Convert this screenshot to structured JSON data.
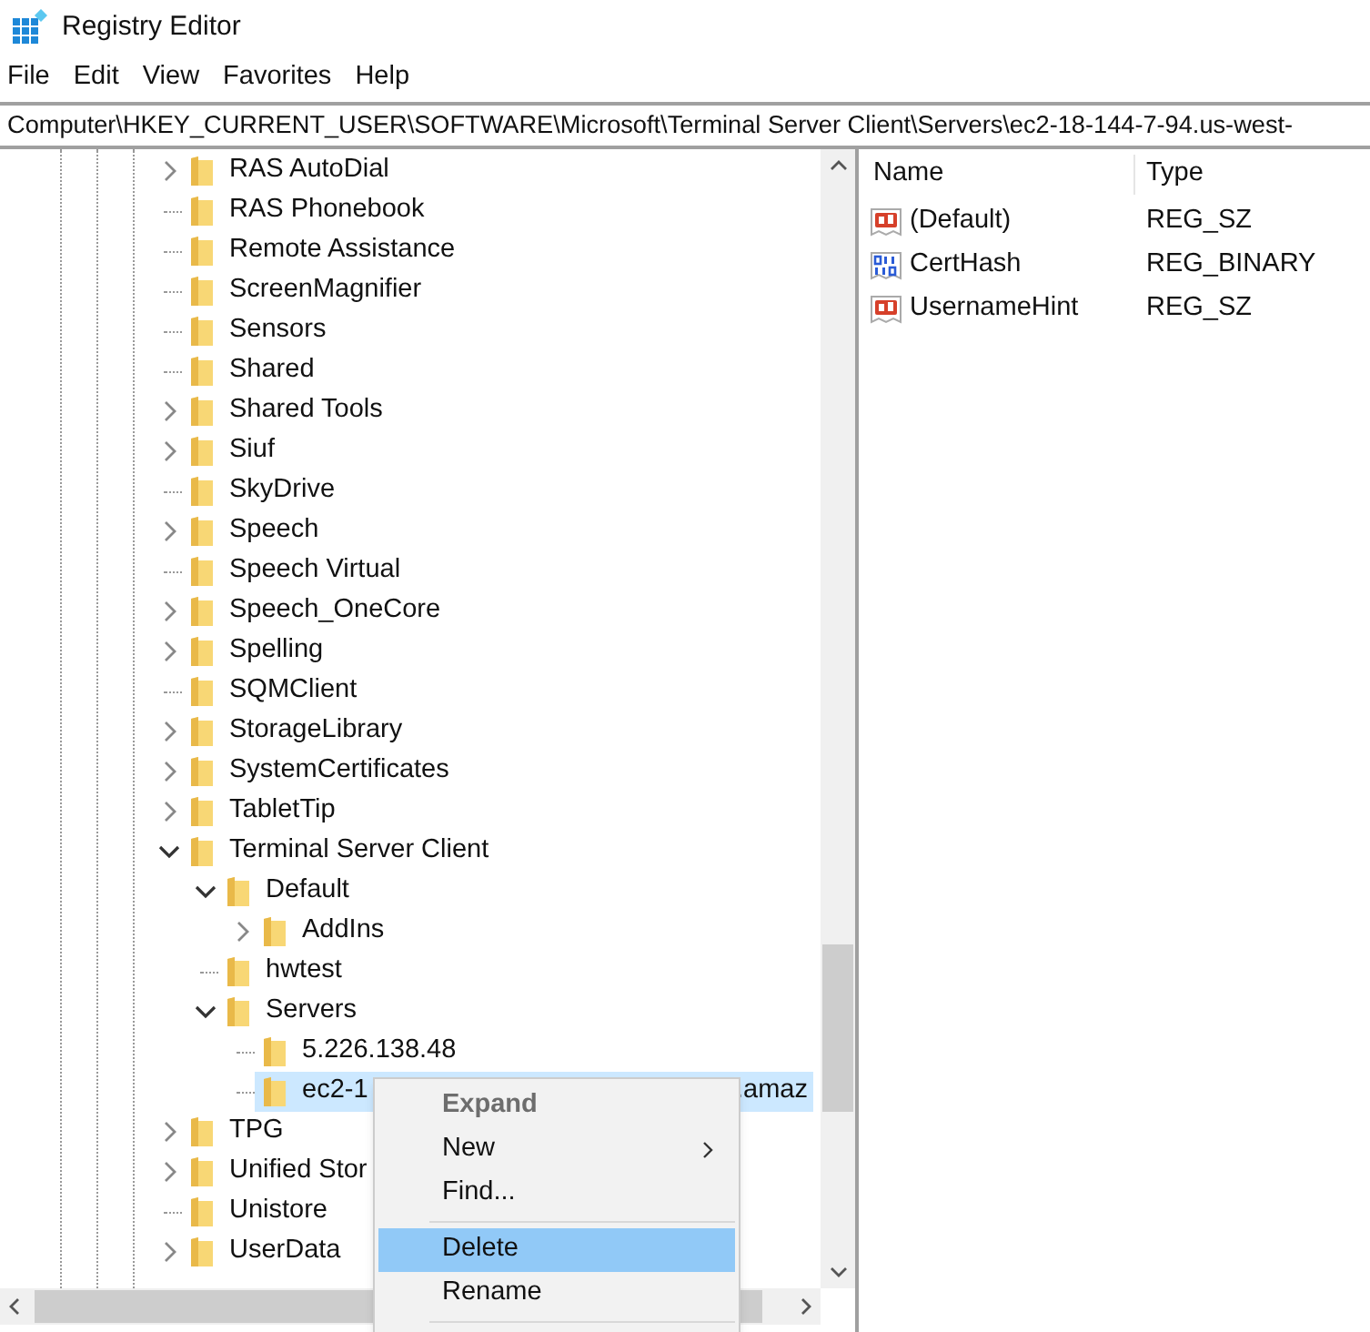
{
  "window": {
    "title": "Registry Editor"
  },
  "menu": [
    "File",
    "Edit",
    "View",
    "Favorites",
    "Help"
  ],
  "address": "Computer\\HKEY_CURRENT_USER\\SOFTWARE\\Microsoft\\Terminal Server Client\\Servers\\ec2-18-144-7-94.us-west-",
  "tree": {
    "items": [
      {
        "label": "RAS AutoDial",
        "expandable": true,
        "expanded": false,
        "selected": false
      },
      {
        "label": "RAS Phonebook",
        "expandable": false,
        "selected": false
      },
      {
        "label": "Remote Assistance",
        "expandable": false,
        "selected": false
      },
      {
        "label": "ScreenMagnifier",
        "expandable": false,
        "selected": false
      },
      {
        "label": "Sensors",
        "expandable": false,
        "selected": false
      },
      {
        "label": "Shared",
        "expandable": false,
        "selected": false
      },
      {
        "label": "Shared Tools",
        "expandable": true,
        "expanded": false,
        "selected": false
      },
      {
        "label": "Siuf",
        "expandable": true,
        "expanded": false,
        "selected": false
      },
      {
        "label": "SkyDrive",
        "expandable": false,
        "selected": false
      },
      {
        "label": "Speech",
        "expandable": true,
        "expanded": false,
        "selected": false
      },
      {
        "label": "Speech Virtual",
        "expandable": false,
        "selected": false
      },
      {
        "label": "Speech_OneCore",
        "expandable": true,
        "expanded": false,
        "selected": false
      },
      {
        "label": "Spelling",
        "expandable": true,
        "expanded": false,
        "selected": false
      },
      {
        "label": "SQMClient",
        "expandable": false,
        "selected": false
      },
      {
        "label": "StorageLibrary",
        "expandable": true,
        "expanded": false,
        "selected": false
      },
      {
        "label": "SystemCertificates",
        "expandable": true,
        "expanded": false,
        "selected": false
      },
      {
        "label": "TabletTip",
        "expandable": true,
        "expanded": false,
        "selected": false
      },
      {
        "label": "Terminal Server Client",
        "expandable": true,
        "expanded": true,
        "selected": false,
        "children": [
          {
            "label": "Default",
            "expandable": true,
            "expanded": true,
            "selected": false,
            "children": [
              {
                "label": "AddIns",
                "expandable": true,
                "expanded": false,
                "selected": false
              }
            ]
          },
          {
            "label": "hwtest",
            "expandable": false,
            "selected": false
          },
          {
            "label": "Servers",
            "expandable": true,
            "expanded": true,
            "selected": false,
            "children": [
              {
                "label": "5.226.138.48",
                "expandable": false,
                "selected": false
              },
              {
                "label": "ec2-1",
                "label_end": ".amaz",
                "expandable": false,
                "selected": true
              }
            ]
          }
        ]
      },
      {
        "label": "TPG",
        "expandable": true,
        "expanded": false,
        "selected": false
      },
      {
        "label": "Unified Stor",
        "expandable": true,
        "expanded": false,
        "selected": false
      },
      {
        "label": "Unistore",
        "expandable": false,
        "selected": false
      },
      {
        "label": "UserData",
        "expandable": true,
        "expanded": false,
        "selected": false
      }
    ]
  },
  "values": {
    "columns": [
      "Name",
      "Type"
    ],
    "rows": [
      {
        "kind": "string",
        "name": "(Default)",
        "type": "REG_SZ"
      },
      {
        "kind": "binary",
        "name": "CertHash",
        "type": "REG_BINARY"
      },
      {
        "kind": "string",
        "name": "UsernameHint",
        "type": "REG_SZ"
      }
    ]
  },
  "context_menu": {
    "items": [
      {
        "kind": "item",
        "label": "Expand",
        "default": true,
        "disabled": true,
        "highlighted": false,
        "submenu": false
      },
      {
        "kind": "item",
        "label": "New",
        "default": false,
        "disabled": false,
        "highlighted": false,
        "submenu": true
      },
      {
        "kind": "item",
        "label": "Find...",
        "default": false,
        "disabled": false,
        "highlighted": false,
        "submenu": false
      },
      {
        "kind": "separator"
      },
      {
        "kind": "item",
        "label": "Delete",
        "default": false,
        "disabled": false,
        "highlighted": true,
        "submenu": false
      },
      {
        "kind": "item",
        "label": "Rename",
        "default": false,
        "disabled": false,
        "highlighted": false,
        "submenu": false
      },
      {
        "kind": "separator"
      }
    ]
  }
}
